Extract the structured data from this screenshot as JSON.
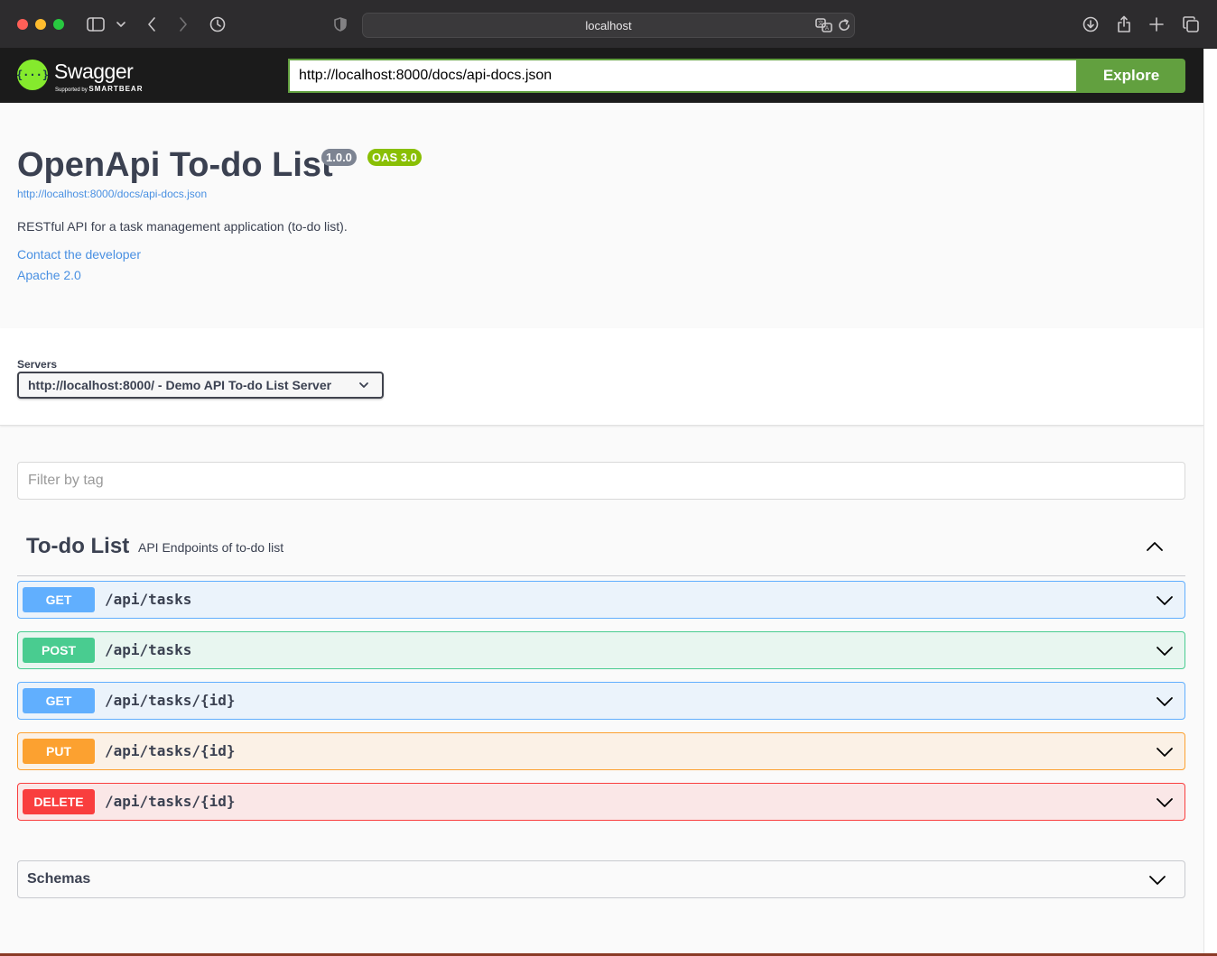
{
  "browser": {
    "address": "localhost",
    "icons": [
      "sidebar-icon",
      "chevron-down-icon",
      "back-icon",
      "forward-icon",
      "history-icon",
      "shield-icon",
      "translate-icon",
      "reload-icon",
      "download-icon",
      "share-icon",
      "new-tab-icon",
      "tabs-overview-icon"
    ]
  },
  "topbar": {
    "logo_name": "Swagger",
    "logo_sub_prefix": "Supported by",
    "logo_sub_brand": "SMARTBEAR",
    "url_value": "http://localhost:8000/docs/api-docs.json",
    "explore_label": "Explore"
  },
  "info": {
    "title": "OpenApi To-do List",
    "version_badge": "1.0.0",
    "oas_badge": "OAS 3.0",
    "spec_link": "http://localhost:8000/docs/api-docs.json",
    "description": "RESTful API for a task management application (to-do list).",
    "contact_link": "Contact the developer",
    "license_link": "Apache 2.0"
  },
  "servers": {
    "label": "Servers",
    "selected": "http://localhost:8000/ - Demo API To-do List Server"
  },
  "filter": {
    "placeholder": "Filter by tag"
  },
  "tag": {
    "name": "To-do List",
    "description": "API Endpoints of to-do list",
    "operations": [
      {
        "method": "GET",
        "path": "/api/tasks"
      },
      {
        "method": "POST",
        "path": "/api/tasks"
      },
      {
        "method": "GET",
        "path": "/api/tasks/{id}"
      },
      {
        "method": "PUT",
        "path": "/api/tasks/{id}"
      },
      {
        "method": "DELETE",
        "path": "/api/tasks/{id}"
      }
    ]
  },
  "schemas": {
    "label": "Schemas"
  },
  "colors": {
    "get": "#61affe",
    "post": "#49cc90",
    "put": "#fca130",
    "delete": "#f93e3e",
    "swagger_green": "#85ea2d",
    "explore_green": "#62a03f",
    "link_blue": "#4990e2"
  }
}
